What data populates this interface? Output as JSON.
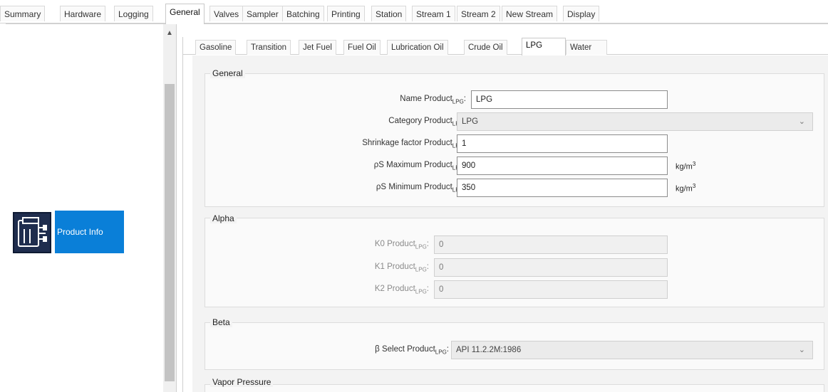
{
  "top_tabs": [
    "Summary",
    "Hardware",
    "Logging",
    "General",
    "Valves",
    "Sampler",
    "Batching",
    "Printing",
    "Station",
    "Stream 1",
    "Stream 2",
    "New Stream",
    "Display"
  ],
  "top_tab_active": "General",
  "left_panel": {
    "tile_label": "Product Info"
  },
  "product_tabs": [
    "Gasoline",
    "Transition",
    "Jet Fuel",
    "Fuel Oil",
    "Lubrication Oil",
    "Crude Oil",
    "LPG",
    "Water"
  ],
  "product_tab_active": "LPG",
  "general": {
    "title": "General",
    "name_label": "Name Product",
    "name_sub": "LPG",
    "name_value": "LPG",
    "category_label": "Category Product",
    "category_sub": "LPG",
    "category_value": "LPG",
    "shrinkage_label": "Shrinkage factor Product",
    "shrinkage_sub": "LPG",
    "shrinkage_value": "1",
    "rho_max_symbol": "ρS",
    "rho_max_label": "Maximum Product",
    "rho_max_sub": "LPG",
    "rho_max_value": "900",
    "rho_max_unit": "kg/m",
    "rho_max_unit_exp": "3",
    "rho_min_symbol": "ρS",
    "rho_min_label": "Minimum Product",
    "rho_min_sub": "LPG",
    "rho_min_value": "350",
    "rho_min_unit": "kg/m",
    "rho_min_unit_exp": "3"
  },
  "alpha": {
    "title": "Alpha",
    "k0_label": "K0 Product",
    "k0_sub": "LPG",
    "k0_value": "0",
    "k1_label": "K1 Product",
    "k1_sub": "LPG",
    "k1_value": "0",
    "k2_label": "K2 Product",
    "k2_sub": "LPG",
    "k2_value": "0"
  },
  "beta": {
    "title": "Beta",
    "select_label": "β Select Product",
    "select_sub": "LPG",
    "select_value": "API 11.2.2M:1986"
  },
  "vapor": {
    "title": "Vapor Pressure"
  }
}
